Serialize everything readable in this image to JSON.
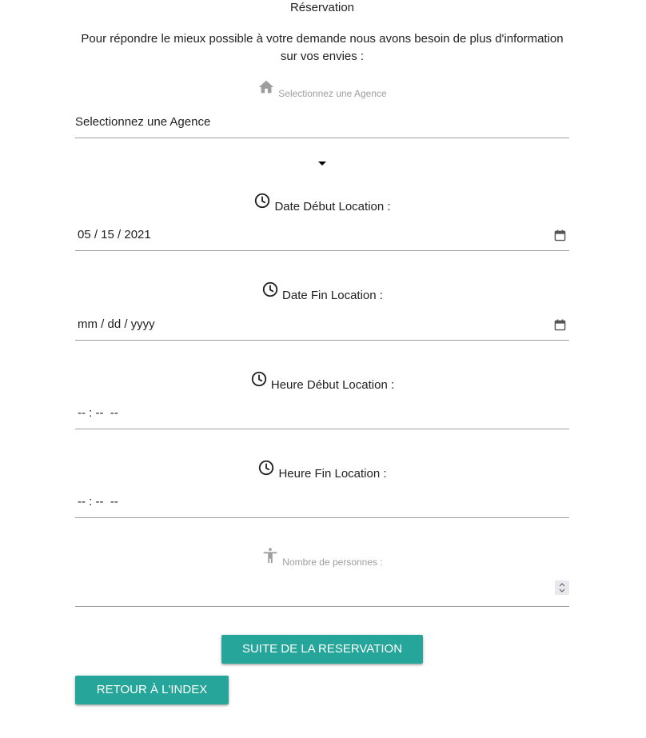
{
  "title": "Réservation",
  "intro": "Pour répondre le mieux possible à votre demande nous avons besoin de plus d'information sur vos envies :",
  "agence": {
    "label": "Selectionnez une Agence",
    "selected": "Selectionnez une Agence",
    "icon": "home-icon"
  },
  "date_debut": {
    "label": "Date Début Location :",
    "value": "05 / 15 / 2021",
    "icon": "clock-icon"
  },
  "date_fin": {
    "label": "Date Fin Location :",
    "value": "mm / dd / yyyy",
    "icon": "clock-icon"
  },
  "heure_debut": {
    "label": "Heure Début Location :",
    "value": "-- : --  --",
    "icon": "clock-icon"
  },
  "heure_fin": {
    "label": "Heure Fin Location :",
    "value": "-- : --  --",
    "icon": "clock-icon"
  },
  "personnes": {
    "label": "Nombre de personnes :",
    "value": "",
    "icon": "accessibility-icon"
  },
  "buttons": {
    "suite": "SUITE DE LA RESERVATION",
    "retour": "RETOUR À L'INDEX"
  },
  "colors": {
    "accent": "#26a69a",
    "grey_label": "#9e9e9e",
    "text": "#212121"
  }
}
